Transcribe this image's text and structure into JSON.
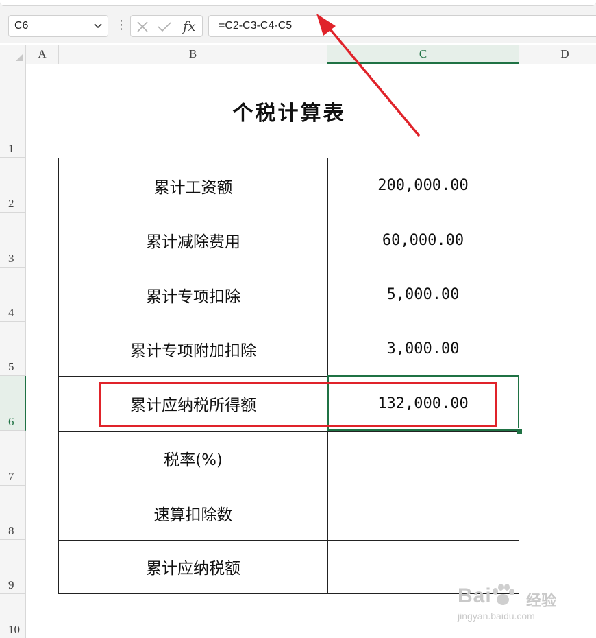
{
  "formula_bar": {
    "name_box": "C6",
    "fx_label": "fx",
    "formula": "=C2-C3-C4-C5"
  },
  "columns": [
    "A",
    "B",
    "C",
    "D"
  ],
  "active_column": "C",
  "rows": [
    "1",
    "2",
    "3",
    "4",
    "5",
    "6",
    "7",
    "8",
    "9",
    "10"
  ],
  "active_row": "6",
  "sheet": {
    "title": "个税计算表",
    "table": [
      {
        "label": "累计工资额",
        "value": "200,000.00"
      },
      {
        "label": "累计减除费用",
        "value": "60,000.00"
      },
      {
        "label": "累计专项扣除",
        "value": "5,000.00"
      },
      {
        "label": "累计专项附加扣除",
        "value": "3,000.00"
      },
      {
        "label": "累计应纳税所得额",
        "value": "132,000.00"
      },
      {
        "label": "税率(%)",
        "value": ""
      },
      {
        "label": "速算扣除数",
        "value": ""
      },
      {
        "label": "累计应纳税额",
        "value": ""
      }
    ]
  },
  "annotations": {
    "highlight_color": "#e0232a",
    "selection_color": "#1f7244"
  },
  "watermark": {
    "main": "Bai",
    "cn": "经验",
    "sub": "jingyan.baidu.com"
  }
}
